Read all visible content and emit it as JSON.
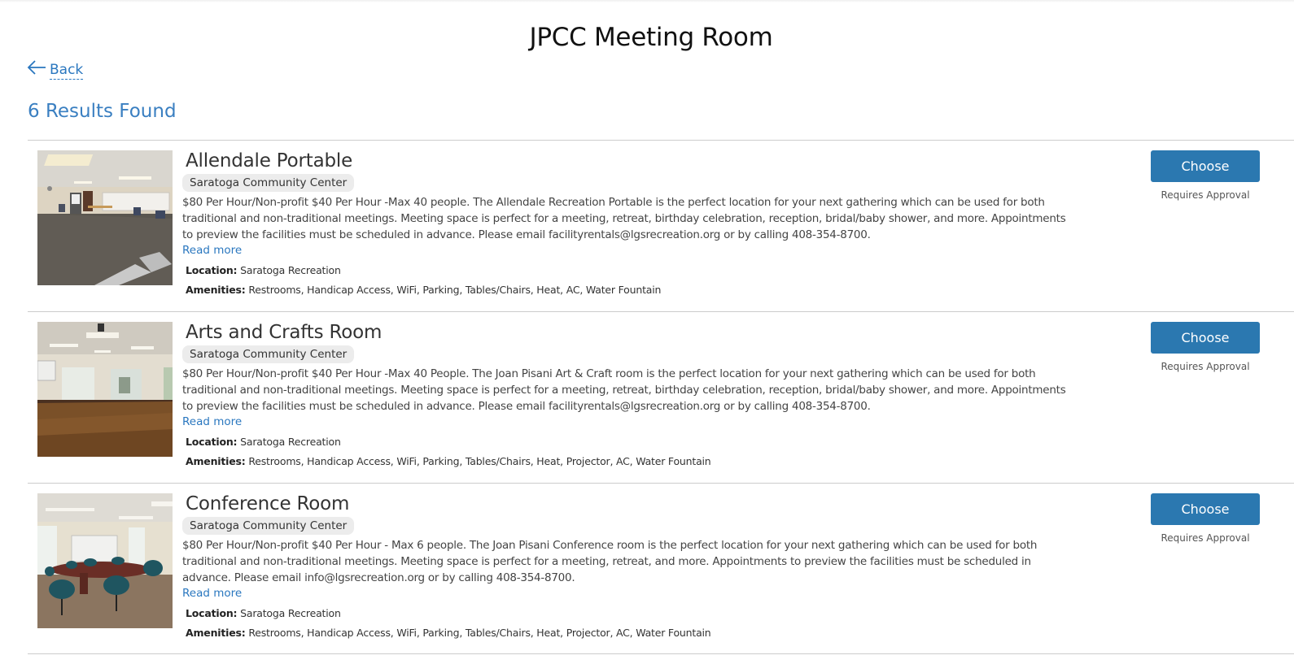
{
  "page": {
    "title": "JPCC Meeting Room",
    "back_label": "Back",
    "back_icon": "arrow-left-icon",
    "results_count": "6 Results Found"
  },
  "colors": {
    "accent": "#2a77bf",
    "button": "#2b78b0",
    "badge_bg": "#ececec"
  },
  "results": [
    {
      "name": "Allendale Portable",
      "facility": "Saratoga Community Center",
      "description": "$80 Per Hour/Non-profit $40 Per Hour -Max 40 people. The Allendale Recreation Portable is the perfect location for your next gathering which can be used for both traditional and non-traditional meetings. Meeting space is perfect for a meeting, retreat, birthday celebration, reception, bridal/baby shower, and more. Appointments to preview the facilities must be scheduled in advance. Please email facilityrentals@lgsrecreation.org or by calling 408-354-8700.",
      "read_more": "Read more",
      "location_label": "Location:",
      "location": "Saratoga Recreation",
      "amenities_label": "Amenities:",
      "amenities": "Restrooms, Handicap Access, WiFi, Parking, Tables/Chairs, Heat, AC, Water Fountain",
      "button_label": "Choose",
      "approval": "Requires Approval",
      "image": "carpeted-room-photo"
    },
    {
      "name": "Arts and Crafts Room",
      "facility": "Saratoga Community Center",
      "description": "$80 Per Hour/Non-profit $40 Per Hour -Max 40 People. The Joan Pisani Art & Craft room is the perfect location for your next gathering which can be used for both traditional and non-traditional meetings. Meeting space is perfect for a meeting, retreat, birthday celebration, reception, bridal/baby shower, and more. Appointments to preview the facilities must be scheduled in advance. Please email facilityrentals@lgsrecreation.org or by calling 408-354-8700.",
      "read_more": "Read more",
      "location_label": "Location:",
      "location": "Saratoga Recreation",
      "amenities_label": "Amenities:",
      "amenities": "Restrooms, Handicap Access, WiFi, Parking, Tables/Chairs, Heat, Projector, AC, Water Fountain",
      "button_label": "Choose",
      "approval": "Requires Approval",
      "image": "wood-floor-room-photo"
    },
    {
      "name": "Conference Room",
      "facility": "Saratoga Community Center",
      "description": "$80 Per Hour/Non-profit $40 Per Hour - Max 6 people. The Joan Pisani Conference room is the perfect location for your next gathering which can be used for both traditional and non-traditional meetings. Meeting space is perfect for a meeting, retreat, and more. Appointments to preview the facilities must be scheduled in advance. Please email info@lgsrecreation.org or by calling 408-354-8700.",
      "read_more": "Read more",
      "location_label": "Location:",
      "location": "Saratoga Recreation",
      "amenities_label": "Amenities:",
      "amenities": "Restrooms, Handicap Access, WiFi, Parking, Tables/Chairs, Heat, Projector, AC, Water Fountain",
      "button_label": "Choose",
      "approval": "Requires Approval",
      "image": "conference-room-photo"
    }
  ]
}
